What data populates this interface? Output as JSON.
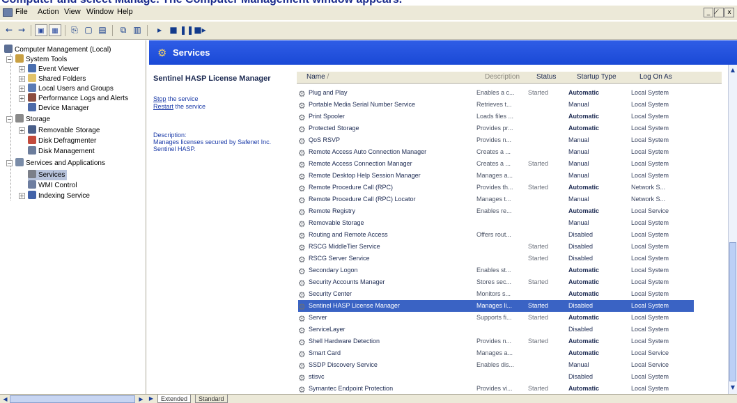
{
  "caption": "Computer and select Manage. The Computer Management window appears.",
  "menubar": {
    "items": [
      "File",
      "Action",
      "View",
      "Window",
      "Help"
    ],
    "window_controls": [
      "_",
      "̸",
      "x"
    ]
  },
  "tree": {
    "items": [
      {
        "label": "Computer Management (Local)",
        "icon_color": "#5c6f95",
        "icon": "computer-icon"
      },
      {
        "label": "System Tools",
        "icon_color": "#c9a042",
        "icon": "system-tools-icon"
      },
      {
        "label": "Event Viewer",
        "icon_color": "#4a6fb0",
        "icon": "event-viewer-icon"
      },
      {
        "label": "Shared Folders",
        "icon_color": "#e2c36a",
        "icon": "shared-folders-icon"
      },
      {
        "label": "Local Users and Groups",
        "icon_color": "#5a7bb5",
        "icon": "users-icon"
      },
      {
        "label": "Performance Logs and Alerts",
        "icon_color": "#8b4c3f",
        "icon": "performance-icon"
      },
      {
        "label": "Device Manager",
        "icon_color": "#4d6aa8",
        "icon": "device-manager-icon"
      },
      {
        "label": "Storage",
        "icon_color": "#8a8a8a",
        "icon": "storage-icon"
      },
      {
        "label": "Removable Storage",
        "icon_color": "#4a5f8a",
        "icon": "removable-storage-icon"
      },
      {
        "label": "Disk Defragmenter",
        "icon_color": "#c34a3c",
        "icon": "defrag-icon"
      },
      {
        "label": "Disk Management",
        "icon_color": "#6c7d9c",
        "icon": "disk-icon"
      },
      {
        "label": "Services and Applications",
        "icon_color": "#7a8ca8",
        "icon": "services-apps-icon"
      },
      {
        "label": "Services",
        "icon_color": "#7b7f88",
        "icon": "services-icon"
      },
      {
        "label": "WMI Control",
        "icon_color": "#6e7ea0",
        "icon": "wmi-icon"
      },
      {
        "label": "Indexing Service",
        "icon_color": "#4262a8",
        "icon": "indexing-icon"
      }
    ]
  },
  "services_header": {
    "title": "Services"
  },
  "description_pane": {
    "service_name": "Sentinel HASP License Manager",
    "stop_link_word": "Stop",
    "stop_link_rest": " the service",
    "restart_link_word": "Restart",
    "restart_link_rest": " the service",
    "description_label": "Description:",
    "description_text": "Manages licenses secured by Safenet Inc. Sentinel HASP."
  },
  "list": {
    "columns": {
      "name": "Name",
      "sort_arrow": "/",
      "description": "Description",
      "status": "Status",
      "startup": "Startup Type",
      "logon": "Log On As"
    },
    "rows": [
      {
        "name": "Plug and Play",
        "description": "Enables a c...",
        "status": "Started",
        "startup": "Automatic",
        "logon": "Local System"
      },
      {
        "name": "Portable Media Serial Number Service",
        "description": "Retrieves t...",
        "status": "",
        "startup": "Manual",
        "logon": "Local System"
      },
      {
        "name": "Print Spooler",
        "description": "Loads files ...",
        "status": "",
        "startup": "Automatic",
        "logon": "Local System"
      },
      {
        "name": "Protected Storage",
        "description": "Provides pr...",
        "status": "",
        "startup": "Automatic",
        "logon": "Local System"
      },
      {
        "name": "QoS RSVP",
        "description": "Provides n...",
        "status": "",
        "startup": "Manual",
        "logon": "Local System"
      },
      {
        "name": "Remote Access Auto Connection Manager",
        "description": "Creates a ...",
        "status": "",
        "startup": "Manual",
        "logon": "Local System"
      },
      {
        "name": "Remote Access Connection Manager",
        "description": "Creates a ...",
        "status": "Started",
        "startup": "Manual",
        "logon": "Local System"
      },
      {
        "name": "Remote Desktop Help Session Manager",
        "description": "Manages a...",
        "status": "",
        "startup": "Manual",
        "logon": "Local System"
      },
      {
        "name": "Remote Procedure Call (RPC)",
        "description": "Provides th...",
        "status": "Started",
        "startup": "Automatic",
        "logon": "Network S..."
      },
      {
        "name": "Remote Procedure Call (RPC) Locator",
        "description": "Manages t...",
        "status": "",
        "startup": "Manual",
        "logon": "Network S..."
      },
      {
        "name": "Remote Registry",
        "description": "Enables re...",
        "status": "",
        "startup": "Automatic",
        "logon": "Local Service"
      },
      {
        "name": "Removable Storage",
        "description": "",
        "status": "",
        "startup": "Manual",
        "logon": "Local System"
      },
      {
        "name": "Routing and Remote Access",
        "description": "Offers rout...",
        "status": "",
        "startup": "Disabled",
        "logon": "Local System"
      },
      {
        "name": "RSCG MiddleTier Service",
        "description": "",
        "status": "Started",
        "startup": "Disabled",
        "logon": "Local System"
      },
      {
        "name": "RSCG Server Service",
        "description": "",
        "status": "Started",
        "startup": "Disabled",
        "logon": "Local System"
      },
      {
        "name": "Secondary Logon",
        "description": "Enables st...",
        "status": "",
        "startup": "Automatic",
        "logon": "Local System"
      },
      {
        "name": "Security Accounts Manager",
        "description": "Stores sec...",
        "status": "Started",
        "startup": "Automatic",
        "logon": "Local System"
      },
      {
        "name": "Security Center",
        "description": "Monitors s...",
        "status": "",
        "startup": "Automatic",
        "logon": "Local System"
      },
      {
        "name": "Sentinel HASP License Manager",
        "description": "Manages li...",
        "status": "Started",
        "startup": "Disabled",
        "logon": "Local System"
      },
      {
        "name": "Server",
        "description": "Supports fi...",
        "status": "Started",
        "startup": "Automatic",
        "logon": "Local System"
      },
      {
        "name": "ServiceLayer",
        "description": "",
        "status": "",
        "startup": "Disabled",
        "logon": "Local System"
      },
      {
        "name": "Shell Hardware Detection",
        "description": "Provides n...",
        "status": "Started",
        "startup": "Automatic",
        "logon": "Local System"
      },
      {
        "name": "Smart Card",
        "description": "Manages a...",
        "status": "",
        "startup": "Automatic",
        "logon": "Local Service"
      },
      {
        "name": "SSDP Discovery Service",
        "description": "Enables dis...",
        "status": "",
        "startup": "Manual",
        "logon": "Local Service"
      },
      {
        "name": "stisvc",
        "description": "",
        "status": "",
        "startup": "Disabled",
        "logon": "Local System"
      },
      {
        "name": "Symantec Endpoint Protection",
        "description": "Provides vi...",
        "status": "Started",
        "startup": "Automatic",
        "logon": "Local System"
      }
    ],
    "selected_index": 18
  },
  "tabs": {
    "extended": "Extended",
    "standard": "Standard",
    "active": "extended"
  },
  "colors": {
    "header_blue": "#1a49d6",
    "selection_blue": "#3a63c4",
    "link_blue": "#1a3aa8",
    "chrome": "#ece9d8"
  }
}
